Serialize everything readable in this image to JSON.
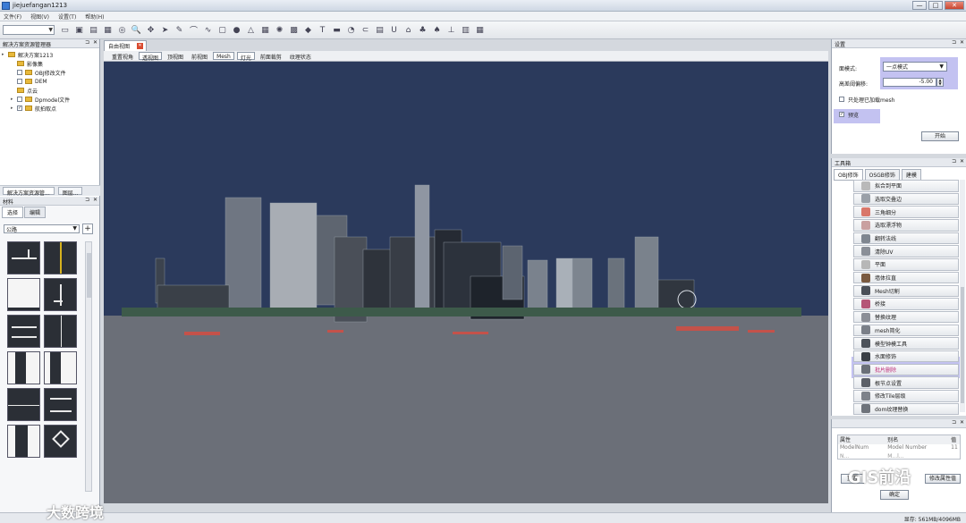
{
  "window": {
    "title": "jiejuefangan1213",
    "buttons": [
      "—",
      "□",
      "✕"
    ]
  },
  "menu": [
    "文件(F)",
    "视图(V)",
    "设置(T)",
    "帮助(H)"
  ],
  "toolbar": {
    "combo_value": "",
    "icons": [
      "open-icon",
      "save-icon",
      "book-icon",
      "layers-icon",
      "target-icon",
      "zoom-icon",
      "pan-icon",
      "select-arrow-icon",
      "brush-icon",
      "lasso-icon",
      "curve-icon",
      "crop-icon",
      "sphere-icon",
      "triangle-icon",
      "grid-icon",
      "star-icon",
      "mesh-icon",
      "eraser-icon",
      "text-icon",
      "box-icon",
      "clock-icon",
      "link-icon",
      "texture-icon",
      "uv-icon",
      "house-icon",
      "tree-icon",
      "bell-icon",
      "hierarchy-icon",
      "document-icon",
      "tile-icon"
    ]
  },
  "solution_panel": {
    "title": "解决方案资源管理器",
    "tree": [
      {
        "label": "解决方案1213",
        "level": 0,
        "type": "folder",
        "expander": "▸"
      },
      {
        "label": "影像集",
        "level": 1,
        "type": "folder"
      },
      {
        "label": "OBJ修改文件",
        "level": 1,
        "type": "folder",
        "checkbox": ""
      },
      {
        "label": "DEM",
        "level": 1,
        "type": "folder",
        "checkbox": ""
      },
      {
        "label": "点云",
        "level": 1,
        "type": "folder"
      },
      {
        "label": "Dpmodel文件",
        "level": 1,
        "type": "folder",
        "checkbox": "",
        "expander": "▸"
      },
      {
        "label": "航拍取点",
        "level": 1,
        "type": "folder",
        "checkbox": "✓",
        "expander": "▸"
      }
    ],
    "tabs": [
      "解决方案资源管...",
      "图层..."
    ]
  },
  "material_panel": {
    "title": "材料",
    "tabs": [
      "选择",
      "编辑"
    ],
    "category": "公路",
    "add_button": "+"
  },
  "view": {
    "tab": "自由视图",
    "buttons": [
      "重置视角",
      "透视图",
      "顶视图",
      "前视图",
      "Mesh",
      "灯光",
      "前面裁剪",
      "纹理状态"
    ],
    "active_buttons": [
      "透视图",
      "Mesh",
      "灯光"
    ]
  },
  "settings": {
    "title": "设置",
    "mode_label": "面模式:",
    "mode_value": "一点模式",
    "offset_label": "高差阈偏移:",
    "offset_value": "-5.00",
    "only_mesh_label": "只处理已加载mesh",
    "preview_label": "预览",
    "start_button": "开始"
  },
  "toolbox": {
    "title": "工具箱",
    "tabs": [
      "OBJ修饰",
      "OSGB修饰",
      "建模"
    ],
    "tools": [
      {
        "label": "拟合到平面",
        "icon": "#b9b9b9"
      },
      {
        "label": "选取交叠边",
        "icon": "#9aa0a8"
      },
      {
        "label": "三角细分",
        "icon": "#d9776a"
      },
      {
        "label": "选取漂浮物",
        "icon": "#c9a0a0"
      },
      {
        "label": "翻转法线",
        "icon": "#7f8690"
      },
      {
        "label": "清除UV",
        "icon": "#8a8f98"
      },
      {
        "label": "平面",
        "icon": "#b7b7b7"
      },
      {
        "label": "墙体拉直",
        "icon": "#7a5a40"
      },
      {
        "label": "Mesh切割",
        "icon": "#4a4f58"
      },
      {
        "label": "桥接",
        "icon": "#b55577"
      },
      {
        "label": "替换纹理",
        "icon": "#8c8f97"
      },
      {
        "label": "mesh简化",
        "icon": "#7a7f88"
      },
      {
        "label": "模型钟模工具",
        "icon": "#4c525a"
      },
      {
        "label": "水面修饰",
        "icon": "#3a3f46"
      },
      {
        "label": "批片删除",
        "icon": "#6a6f78"
      },
      {
        "label": "根节点设置",
        "icon": "#5c6068"
      },
      {
        "label": "修改Tile层级",
        "icon": "#7d828a"
      },
      {
        "label": "dom纹理替换",
        "icon": "#6e737b"
      }
    ],
    "selected_tool": "批片删除"
  },
  "properties": {
    "headers": [
      "属性",
      "别名",
      "值"
    ],
    "rows": [
      [
        "ModelNum",
        "Model Number",
        "11"
      ],
      [
        "N...",
        "M...l...",
        ""
      ]
    ],
    "buttons": [
      "重置",
      "确定",
      "修改属性值"
    ]
  },
  "status": {
    "memory": "显存: 561MB/4096MB"
  },
  "watermarks": [
    "GIS前沿",
    "大数跨境"
  ],
  "colors": {
    "sky": "#2b3a5c",
    "ground": "#6b6f78",
    "highlight": "#b9b7ee"
  }
}
